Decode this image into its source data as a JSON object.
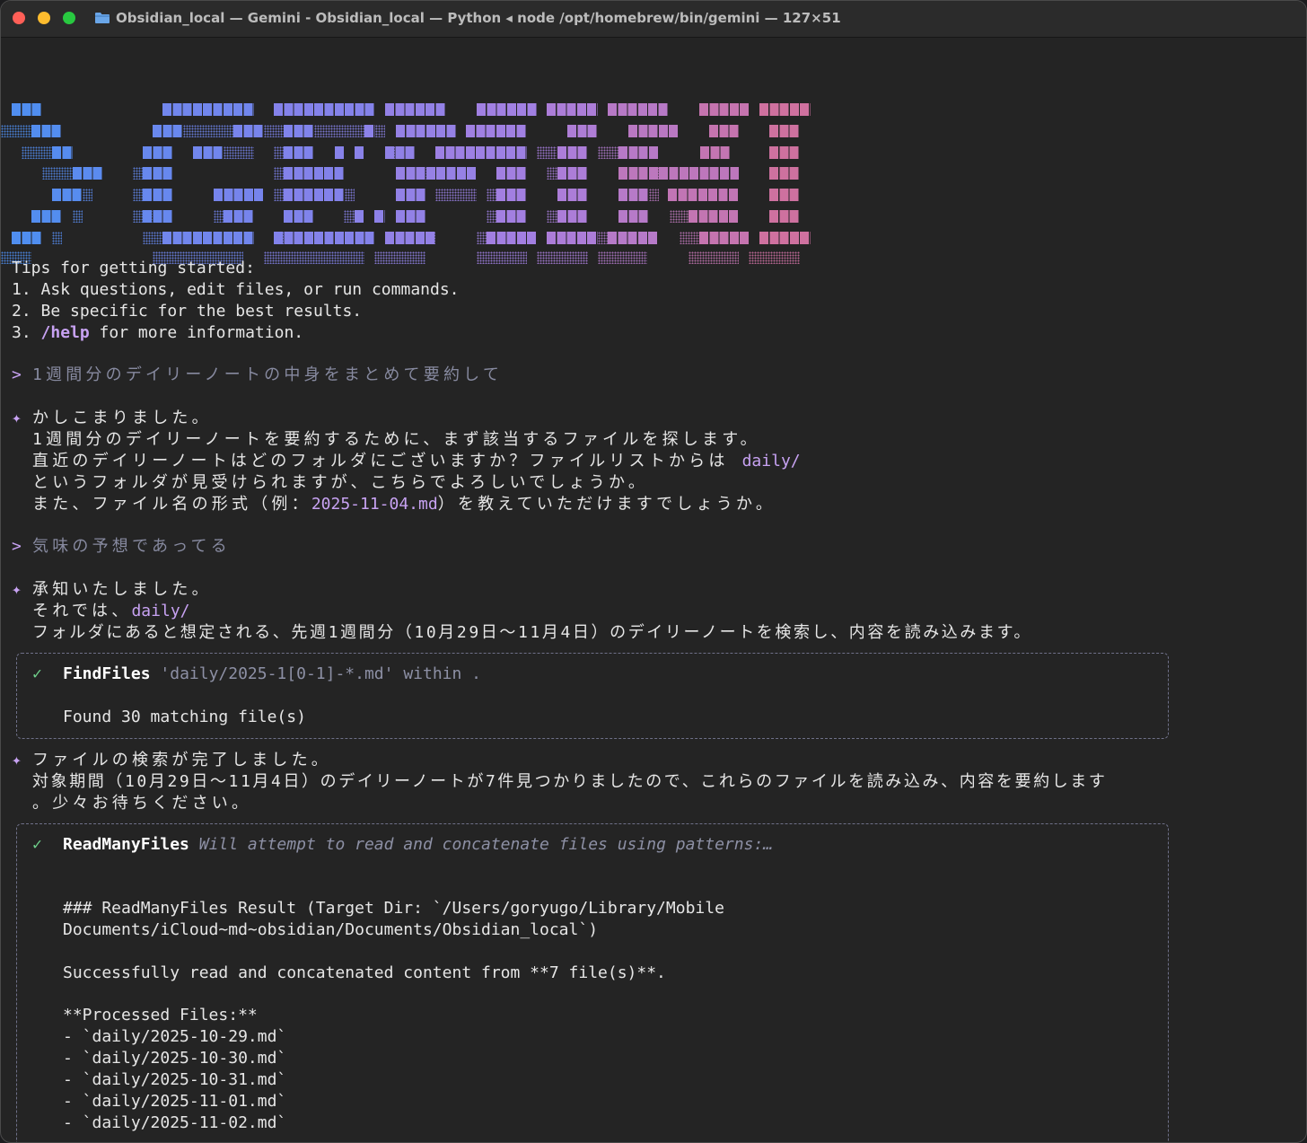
{
  "window": {
    "title": "Obsidian_local — Gemini - Obsidian_local — Python ◂ node /opt/homebrew/bin/gemini — 127×51"
  },
  "icons": {
    "window_icon": "folder-icon",
    "user_prompt_marker": ">",
    "response_marker": "✦",
    "success_marker": "✓"
  },
  "colors": {
    "background": "#242424",
    "logo_gradient": [
      "#4b8ff0",
      "#7c83ec",
      "#a77fe0",
      "#d36f98"
    ],
    "accent": "#c7a2f2",
    "success": "#6fd08b"
  },
  "tips": {
    "heading": "Tips for getting started:",
    "item1": "1. Ask questions, edit files, or run commands.",
    "item2": "2. Be specific for the best results.",
    "item3_prefix": "3. ",
    "item3_command": "/help",
    "item3_suffix": " for more information."
  },
  "conversation": {
    "user1": "1週間分のデイリーノートの中身をまとめて要約して",
    "bot1_line1": "かしこまりました。",
    "bot1_line2": "1週間分のデイリーノートを要約するために、まず該当するファイルを探します。",
    "bot1_line3_prefix": "直近のデイリーノートはどのフォルダにございますか？ファイルリストからは ",
    "bot1_line3_path": "daily/",
    "bot1_line4": "というフォルダが見受けられますが、こちらでよろしいでしょうか。",
    "bot1_line5_prefix": "また、ファイル名の形式（例：",
    "bot1_line5_example": "2025-11-04.md",
    "bot1_line5_suffix": "）を教えていただけますでしょうか。",
    "user2": "気味の予想であってる",
    "bot2_line1": "承知いたしました。",
    "bot2_line2_prefix": "それでは、",
    "bot2_line2_path": "daily/",
    "bot2_line3": "フォルダにあると想定される、先週1週間分（10月29日〜11月4日）のデイリーノートを検索し、内容を読み込みます。",
    "bot3_line1": "ファイルの検索が完了しました。",
    "bot3_line2": "対象期間（10月29日〜11月4日）のデイリーノートが7件見つかりましたので、これらのファイルを読み込み、内容を要約します",
    "bot3_line3": "。少々お待ちください。"
  },
  "tool_find": {
    "name": "FindFiles",
    "args": "'daily/2025-1[0-1]-*.md' within .",
    "result": "Found 30 matching file(s)"
  },
  "tool_read": {
    "name": "ReadManyFiles",
    "desc": "Will attempt to read and concatenate files using patterns:…",
    "line1": "### ReadManyFiles Result (Target Dir: `/Users/goryugo/Library/Mobile",
    "line2": "Documents/iCloud~md~obsidian/Documents/Obsidian_local`)",
    "line3": "Successfully read and concatenated content from **7 file(s)**.",
    "processed_heading": "**Processed Files:**",
    "files": [
      "- `daily/2025-10-29.md`",
      "- `daily/2025-10-30.md`",
      "- `daily/2025-10-31.md`",
      "- `daily/2025-11-01.md`",
      "- `daily/2025-11-02.md`"
    ]
  }
}
